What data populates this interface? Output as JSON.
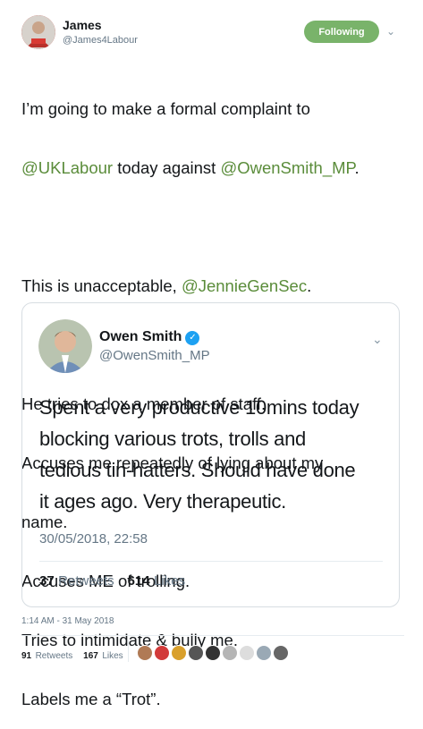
{
  "author": {
    "name": "James",
    "handle": "@James4Labour"
  },
  "follow": {
    "label": "Following"
  },
  "tweet": {
    "line1_pre": "I’m going to make a formal complaint to",
    "line2_mention1": "@UKLabour",
    "line2_mid": " today against ",
    "line2_mention2": "@OwenSmith_MP",
    "line2_end": ".",
    "line3_pre": "This is unacceptable, ",
    "line3_mention": "@JennieGenSec",
    "line3_end": ".",
    "lines": [
      "He tries to dox a member of staff.",
      "Accuses me repeatedly of lying about my",
      "name.",
      "Accuses ME of trolling.",
      "Tries to intimidate & bully me.",
      "Labels me a “Trot”."
    ]
  },
  "quoted": {
    "name": "Owen Smith",
    "handle": "@OwenSmith_MP",
    "text_lines": [
      "Spent a very productive 10mins today",
      "blocking various trots, trolls and",
      "tedious tin-hatters. Should have done",
      "it ages ago. Very therapeutic."
    ],
    "date": "30/05/2018, 22:58",
    "retweets_count": "37",
    "retweets_label": "Retweets",
    "likes_count": "614",
    "likes_label": "Likes"
  },
  "timestamp": "1:14 AM - 31 May 2018",
  "stats": {
    "retweets_count": "91",
    "retweets_label": "Retweets",
    "likes_count": "167",
    "likes_label": "Likes"
  },
  "colors": {
    "mention": "#5a8c3a",
    "follow_button": "#79b36a",
    "verified": "#1da1f2"
  }
}
